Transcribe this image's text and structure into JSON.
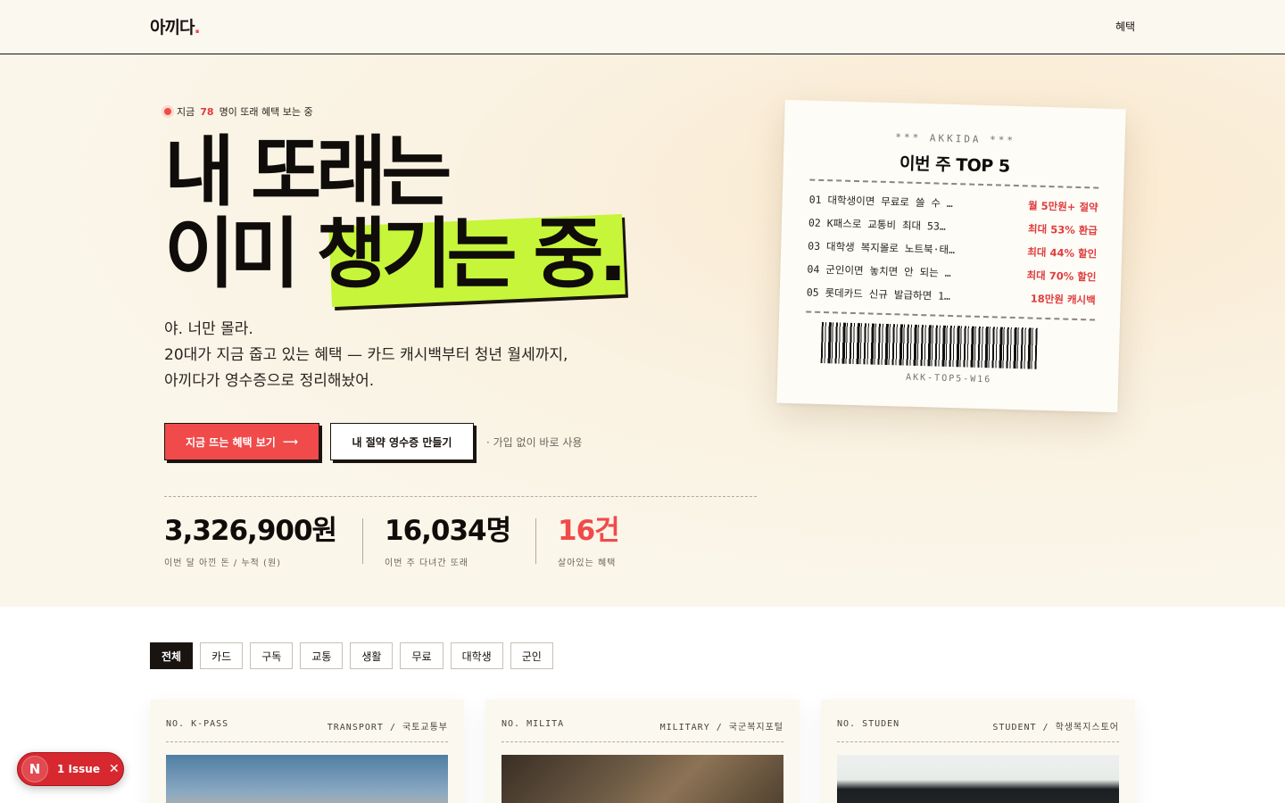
{
  "header": {
    "logo_text": "아끼다",
    "logo_dot": ".",
    "nav_benefit": "혜택"
  },
  "hero": {
    "live_prefix": "지금",
    "live_count": "78",
    "live_suffix": "명이 또래 혜택 보는 중",
    "headline_line1": "내 또래는",
    "headline_line2_a": "이미",
    "headline_line2_b": "챙기는 중.",
    "desc_line1": "야. 너만 몰라.",
    "desc_line2": "20대가 지금 줍고 있는 혜택 — 카드 캐시백부터 청년 월세까지,",
    "desc_line3": "아끼다가 영수증으로 정리해놨어.",
    "primary_button": "지금 뜨는 혜택 보기",
    "primary_arrow": "⟶",
    "secondary_button": "내 절약 영수증 만들기",
    "no_signup": "· 가입 없이 바로 사용",
    "stats": [
      {
        "value": "3,326,900원",
        "label": "이번 달 아낀 돈 / 누적 (원)"
      },
      {
        "value": "16,034명",
        "label": "이번 주 다녀간 또래"
      },
      {
        "value": "16건",
        "label": "살아있는 혜택"
      }
    ]
  },
  "receipt": {
    "brand": "*** AKKIDA ***",
    "title": "이번 주 TOP 5",
    "rows": [
      {
        "left": "01 대학생이면 무료로 쓸 수 …",
        "right": "월 5만원+ 절약"
      },
      {
        "left": "02 K패스로 교통비 최대 53…",
        "right": "최대 53% 환급"
      },
      {
        "left": "03 대학생 복지몰로 노트북·태…",
        "right": "최대 44% 할인"
      },
      {
        "left": "04 군인이면 놓치면 안 되는 …",
        "right": "최대 70% 할인"
      },
      {
        "left": "05 롯데카드 신규 발급하면 1…",
        "right": "18만원 캐시백"
      }
    ],
    "code": "AKK-TOP5-W16"
  },
  "filters": [
    "전체",
    "카드",
    "구독",
    "교통",
    "생활",
    "무료",
    "대학생",
    "군인"
  ],
  "cards": [
    {
      "no": "NO. K-PASS",
      "category": "TRANSPORT / 국토교통부"
    },
    {
      "no": "NO. MILITA",
      "category": "MILITARY / 국군복지포털"
    },
    {
      "no": "NO. STUDEN",
      "category": "STUDENT / 학생복지스토어"
    }
  ],
  "issue_badge": {
    "letter": "N",
    "text": "1 Issue",
    "close": "✕"
  },
  "colors": {
    "accent_red": "#f04a4a",
    "accent_green": "#c6f53a",
    "ink": "#1a1410",
    "paper": "#fbf8f0"
  }
}
